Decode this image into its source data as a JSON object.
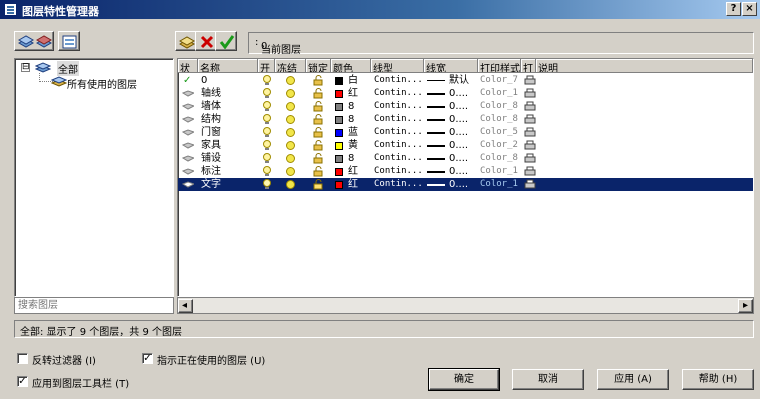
{
  "window": {
    "title": "图层特性管理器",
    "help_button": "?",
    "close_button": "×"
  },
  "toolbar": {
    "current_layer_label": "当前图层",
    "current_layer_value": "0"
  },
  "tree": {
    "root_label": "全部",
    "expander": "⊟",
    "child_label": "所有使用的图层"
  },
  "search": {
    "placeholder": "搜索图层"
  },
  "table": {
    "columns": [
      "状",
      "名称",
      "开",
      "冻结",
      "锁定",
      "颜色",
      "线型",
      "线宽",
      "打印样式",
      "打",
      "说明"
    ],
    "rows": [
      {
        "status": "✓",
        "name": "0",
        "color_name": "白",
        "swatch": "#000000",
        "linetype": "Contin...",
        "lineweight": "默认",
        "lw_thick": false,
        "plotstyle": "Color_7"
      },
      {
        "status": "",
        "name": "轴线",
        "color_name": "红",
        "swatch": "#ff0000",
        "linetype": "Contin...",
        "lineweight": "0....",
        "lw_thick": true,
        "plotstyle": "Color_1"
      },
      {
        "status": "",
        "name": "墙体",
        "color_name": "8",
        "swatch": "#808080",
        "linetype": "Contin...",
        "lineweight": "0....",
        "lw_thick": true,
        "plotstyle": "Color_8"
      },
      {
        "status": "",
        "name": "结构",
        "color_name": "8",
        "swatch": "#808080",
        "linetype": "Contin...",
        "lineweight": "0....",
        "lw_thick": true,
        "plotstyle": "Color_8"
      },
      {
        "status": "",
        "name": "门窗",
        "color_name": "蓝",
        "swatch": "#0000ff",
        "linetype": "Contin...",
        "lineweight": "0....",
        "lw_thick": true,
        "plotstyle": "Color_5"
      },
      {
        "status": "",
        "name": "家具",
        "color_name": "黄",
        "swatch": "#ffff00",
        "linetype": "Contin...",
        "lineweight": "0....",
        "lw_thick": true,
        "plotstyle": "Color_2"
      },
      {
        "status": "",
        "name": "铺设",
        "color_name": "8",
        "swatch": "#808080",
        "linetype": "Contin...",
        "lineweight": "0....",
        "lw_thick": true,
        "plotstyle": "Color_8"
      },
      {
        "status": "",
        "name": "标注",
        "color_name": "红",
        "swatch": "#ff0000",
        "linetype": "Contin...",
        "lineweight": "0....",
        "lw_thick": true,
        "plotstyle": "Color_1"
      },
      {
        "status": "",
        "name": "文字",
        "color_name": "红",
        "swatch": "#ff0000",
        "linetype": "Contin...",
        "lineweight": "0....",
        "lw_thick": true,
        "plotstyle": "Color_1",
        "selected": true
      }
    ]
  },
  "scroll": {
    "left_arrow": "◂",
    "right_arrow": "▸"
  },
  "status": {
    "text": "全部: 显示了 9 个图层，共 9 个图层"
  },
  "options": {
    "invert_filter": {
      "label": "反转过滤器 (I)",
      "checked": false,
      "mark": ""
    },
    "show_used": {
      "label": "指示正在使用的图层 (U)",
      "checked": true,
      "mark": "✓"
    },
    "apply_toolbar": {
      "label": "应用到图层工具栏 (T)",
      "checked": true,
      "mark": "✓"
    }
  },
  "buttons": {
    "ok": "确定",
    "cancel": "取消",
    "apply": "应用 (A)",
    "help": "帮助 (H)"
  },
  "colors": {
    "title_bar": "#0a246a",
    "selection": "#0a246a",
    "face": "#d4d0c8"
  }
}
